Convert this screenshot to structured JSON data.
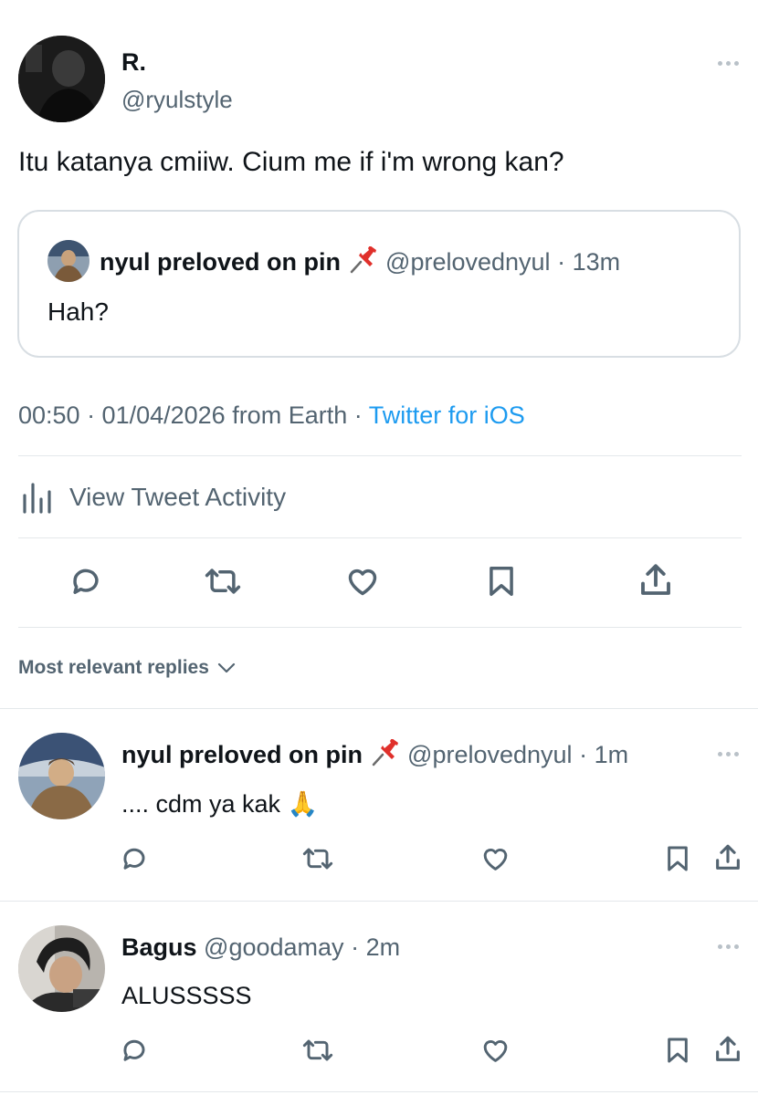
{
  "tweet": {
    "display_name": "R.",
    "handle": "@ryulstyle",
    "text": "Itu katanya cmiiw. Cium me if i'm wrong kan?",
    "quoted": {
      "display_name": "nyul preloved on pin",
      "handle": "@prelovednyul",
      "separator": "·",
      "time": "13m",
      "text": "Hah?"
    },
    "meta_time_date": "00:50 · 01/04/2026 from Earth ·",
    "meta_source": "Twitter for iOS",
    "activity_label": "View Tweet Activity"
  },
  "replies_header": "Most relevant replies",
  "replies": [
    {
      "display_name": "nyul preloved on pin",
      "handle": "@prelovednyul",
      "separator": "·",
      "time": "1m",
      "text": ".... cdm ya kak 🙏"
    },
    {
      "display_name": "Bagus",
      "handle": "@goodamay",
      "separator": "·",
      "time": "2m",
      "text": "ALUSSSSS"
    }
  ],
  "icons": {
    "reply": "reply-icon",
    "retweet": "retweet-icon",
    "like": "like-icon",
    "bookmark": "bookmark-icon",
    "share": "share-icon",
    "activity": "activity-chart-icon",
    "pin": "pushpin-icon",
    "chevron": "chevron-down-icon"
  },
  "colors": {
    "link": "#1d9bf0",
    "text": "#0f1419",
    "muted": "#536471",
    "divider": "#e4e8eb"
  }
}
